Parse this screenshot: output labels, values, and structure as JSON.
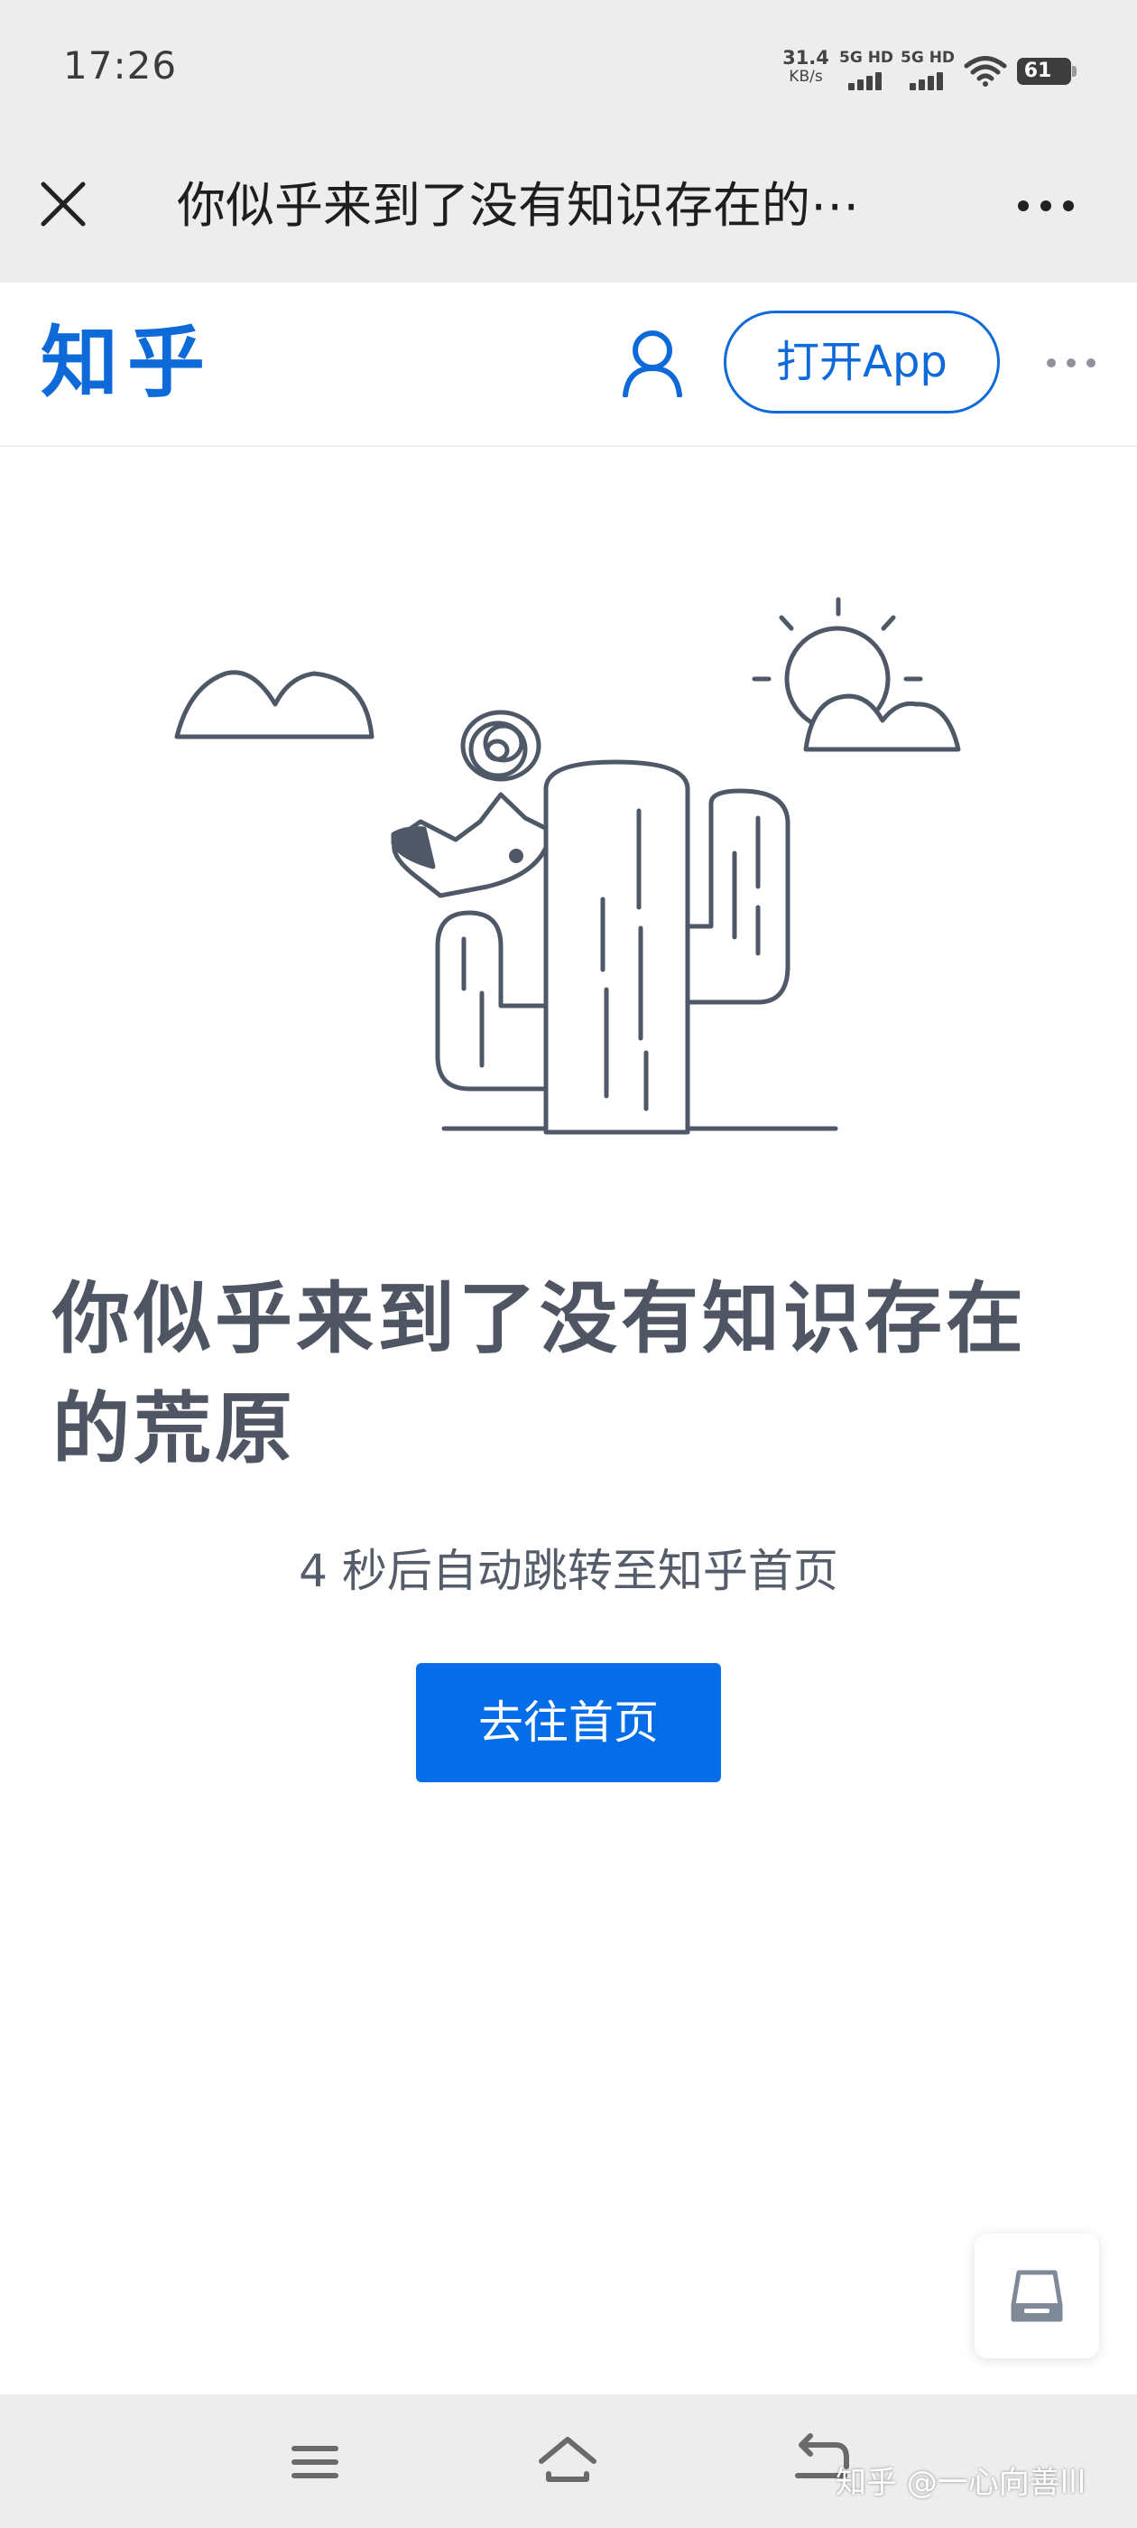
{
  "status_bar": {
    "time": "17:26",
    "net_speed": "31.4",
    "net_speed_unit": "KB/s",
    "signal_1_label": "5G HD",
    "signal_2_label": "5G HD",
    "battery": "61"
  },
  "browser": {
    "title": "你似乎来到了没有知识存在的⋯"
  },
  "header": {
    "logo": "知乎",
    "open_app_label": "打开App"
  },
  "content": {
    "error_title": "你似乎来到了没有知识存在的荒原",
    "redirect_text": "4 秒后自动跳转至知乎首页",
    "home_button_label": "去往首页"
  },
  "watermark": "知乎 @一心向善lll",
  "colors": {
    "brand_blue": "#056de8",
    "illustration_stroke": "#4f5866",
    "title_text": "#4f5562"
  },
  "icons": {
    "close": "close-icon",
    "more": "more-dots-icon",
    "user": "user-icon",
    "widget": "storage-icon",
    "menu": "menu-icon",
    "home": "home-icon",
    "back": "back-icon"
  }
}
